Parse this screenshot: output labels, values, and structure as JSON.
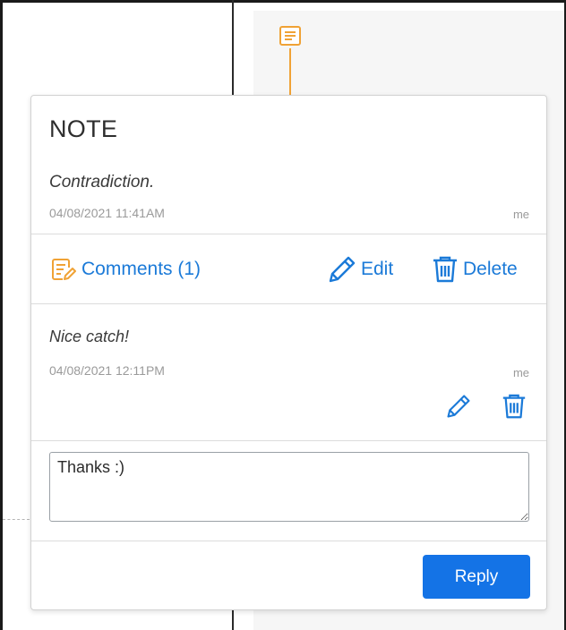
{
  "note": {
    "title": "NOTE",
    "text": "Contradiction.",
    "date": "04/08/2021 11:41AM",
    "author": "me"
  },
  "actions": {
    "comments_label": "Comments (1)",
    "edit_label": "Edit",
    "delete_label": "Delete"
  },
  "comments": [
    {
      "text": "Nice catch!",
      "date": "04/08/2021 12:11PM",
      "author": "me"
    }
  ],
  "reply": {
    "input_value": "Thanks :)",
    "button_label": "Reply"
  },
  "colors": {
    "accent": "#1b7ad8",
    "button": "#1473e6",
    "note_pin": "#f0a235"
  },
  "icons": {
    "pin": "note-pin-icon",
    "comments": "comments-icon",
    "edit": "pencil-icon",
    "delete": "trash-icon"
  }
}
